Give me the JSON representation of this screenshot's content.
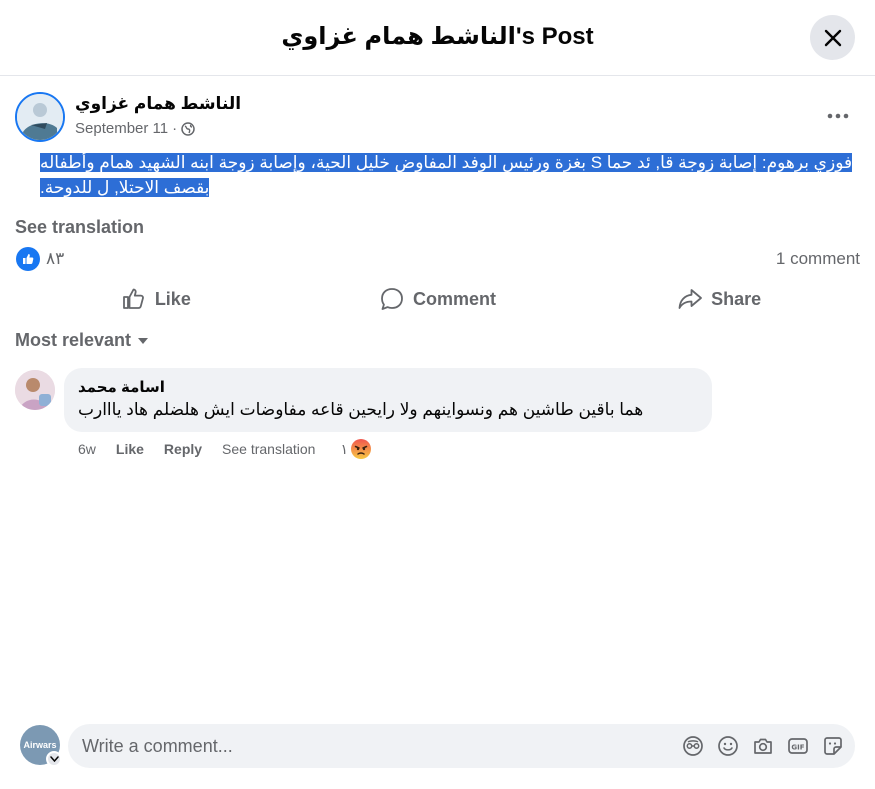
{
  "header": {
    "title": "الناشط همام غزاوي's Post"
  },
  "post": {
    "author": "الناشط همام غزاوي",
    "date": "September 11",
    "separator": "·",
    "text": "فوزي برهوم: إصابة زوجة قا, ئد حما S بغزة ورئيس الوفد المفاوض خليل الحية، وإصابة زوجة ابنه الشهيد همام وأطفاله بقصف الاحتلا, ل للدوحة.",
    "see_translation": "See translation",
    "reaction_count": "٨٣",
    "comment_count": "1 comment"
  },
  "actions": {
    "like": "Like",
    "comment": "Comment",
    "share": "Share"
  },
  "sort": {
    "label": "Most relevant"
  },
  "comment": {
    "name": "اسامة محمد",
    "text": "هما باقين طاشين هم ونسواينهم ولا رايحين قاعه مفاوضات ايش هلضلم هاد يااارب",
    "time": "6w",
    "like": "Like",
    "reply": "Reply",
    "see_translation": "See translation",
    "reaction_count": "١"
  },
  "composer": {
    "avatar_text": "Airwars",
    "placeholder": "Write a comment..."
  },
  "icons": {
    "close": "close-icon",
    "more": "more-horizontal-icon",
    "privacy": "globe-icon",
    "like_reaction": "thumbs-up-reaction-icon",
    "angry_reaction": "angry-reaction-icon",
    "input": [
      "avatar-sticker-icon",
      "emoji-icon",
      "camera-icon",
      "gif-icon",
      "sticker-icon"
    ]
  },
  "colors": {
    "accent": "#1877f2",
    "text_secondary": "#65676b",
    "bubble": "#f0f2f5",
    "selection": "#2d6ed6"
  }
}
